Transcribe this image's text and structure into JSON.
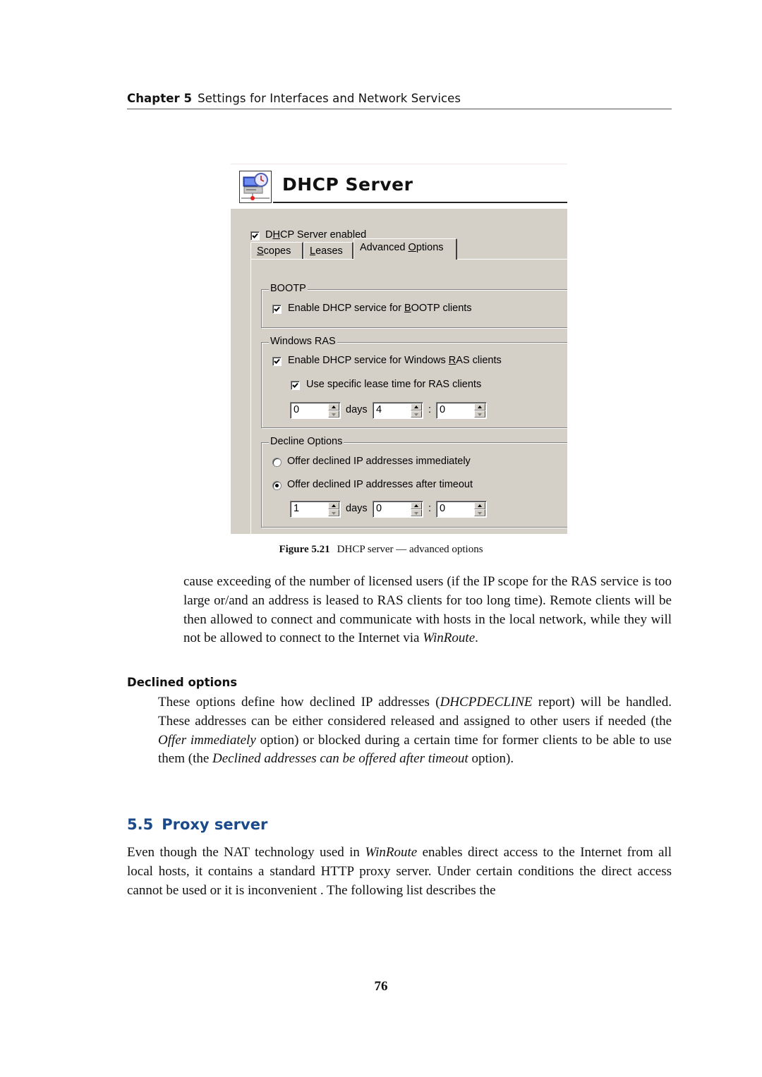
{
  "running_head": {
    "chapter_label": "Chapter 5",
    "chapter_title": "Settings for Interfaces and Network Services"
  },
  "dialog": {
    "icon": "dhcp-server-computer-clock-icon",
    "title": "DHCP Server",
    "server_enabled": {
      "label_pre": "D",
      "label_u": "H",
      "label_post": "CP Server enabled",
      "checked": true
    },
    "tabs": [
      {
        "u": "S",
        "rest": "copes",
        "active": false
      },
      {
        "u": "L",
        "rest": "eases",
        "active": false
      },
      {
        "pre": "Advanced ",
        "u": "O",
        "rest": "ptions",
        "active": true
      }
    ],
    "bootp": {
      "title": "BOOTP",
      "enable": {
        "pre": "Enable DHCP service for ",
        "u": "B",
        "post": "OOTP clients",
        "checked": true
      }
    },
    "windows_ras": {
      "title": "Windows RAS",
      "enable": {
        "pre": "Enable DHCP service for Windows ",
        "u": "R",
        "post": "AS clients",
        "checked": true
      },
      "specific_lease": {
        "label": "Use specific lease time for RAS clients",
        "checked": true
      },
      "days": "0",
      "days_label": "days",
      "hours": "4",
      "separator": ":",
      "minutes": "0"
    },
    "decline_options": {
      "title": "Decline Options",
      "immediately": {
        "label": "Offer declined IP addresses immediately",
        "selected": false
      },
      "after_timeout": {
        "label": "Offer declined IP addresses after timeout",
        "selected": true
      },
      "days": "1",
      "days_label": "days",
      "hours": "0",
      "separator": ":",
      "minutes": "0"
    }
  },
  "caption": {
    "label": "Figure 5.21",
    "text": "DHCP server — advanced options"
  },
  "paragraph1": {
    "text": "cause exceeding of the number of licensed users (if the IP scope for the RAS service is too large or/and an address is leased to RAS clients for too long time).  Remote clients will be then allowed to connect and communicate with hosts in the local network, while they will not be allowed to connect to the Internet via ",
    "em": "WinRoute",
    "end": "."
  },
  "declined_options": {
    "heading": "Declined options",
    "t1": "These options define how declined IP addresses (",
    "em1": "DHCPDECLINE",
    "t2": " report) will be handled.  These addresses can be either considered released and assigned to other users if needed (the ",
    "em2": "Offer immediately",
    "t3": " option) or blocked during a certain time for former clients to be able to use them (the ",
    "em3": "Declined addresses can be offered after timeout",
    "t4": " option)."
  },
  "section": {
    "number": "5.5",
    "title": "Proxy server",
    "color": "#1a4a8a",
    "t1": "Even though the NAT technology used in ",
    "em1": "WinRoute",
    "t2": " enables direct access to the Internet from all local hosts, it contains a standard HTTP proxy server. Under certain conditions the direct access cannot be used or it is inconvenient .  The following list describes the"
  },
  "page_number": "76"
}
